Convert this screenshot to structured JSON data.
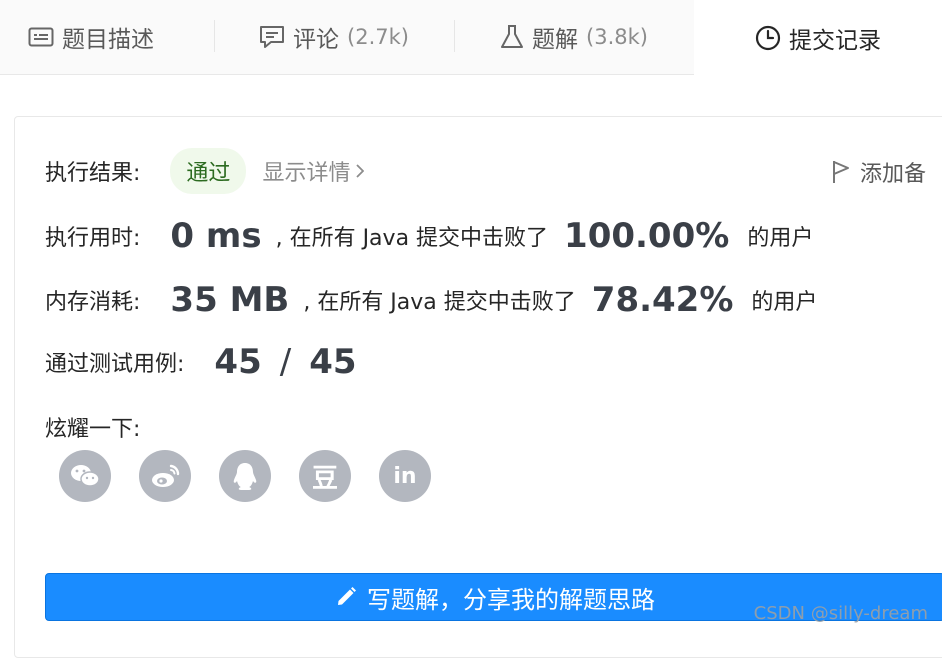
{
  "tabs": [
    {
      "label": "题目描述",
      "count": "",
      "icon": "description-icon"
    },
    {
      "label": "评论",
      "count": "(2.7k)",
      "icon": "comment-icon"
    },
    {
      "label": "题解",
      "count": "(3.8k)",
      "icon": "flask-icon"
    },
    {
      "label": "提交记录",
      "count": "",
      "icon": "clock-icon",
      "active": true
    }
  ],
  "result": {
    "label": "执行结果:",
    "status": "通过",
    "details_link": "显示详情",
    "add_note": "添加备"
  },
  "runtime": {
    "label": "执行用时:",
    "value": "0 ms",
    "middle": ", 在所有 Java 提交中击败了",
    "percent": "100.00%",
    "suffix": "的用户"
  },
  "memory": {
    "label": "内存消耗:",
    "value": "35 MB",
    "middle": ", 在所有 Java 提交中击败了",
    "percent": "78.42%",
    "suffix": "的用户"
  },
  "tests": {
    "label": "通过测试用例:",
    "passed": "45",
    "divider": "/",
    "total": "45"
  },
  "share": {
    "label": "炫耀一下:",
    "icons": [
      "wechat-icon",
      "weibo-icon",
      "qq-icon",
      "douban-icon",
      "linkedin-icon"
    ],
    "douban_glyph": "豆",
    "linkedin_glyph": "in"
  },
  "cta": {
    "label": "写题解，分享我的解题思路"
  },
  "watermark": "CSDN @silly-dream",
  "colors": {
    "accent": "#1a8cff",
    "success_bg": "#f0f9eb",
    "success_text": "#2c6b20",
    "share_icon_bg": "#b3b7bf"
  }
}
